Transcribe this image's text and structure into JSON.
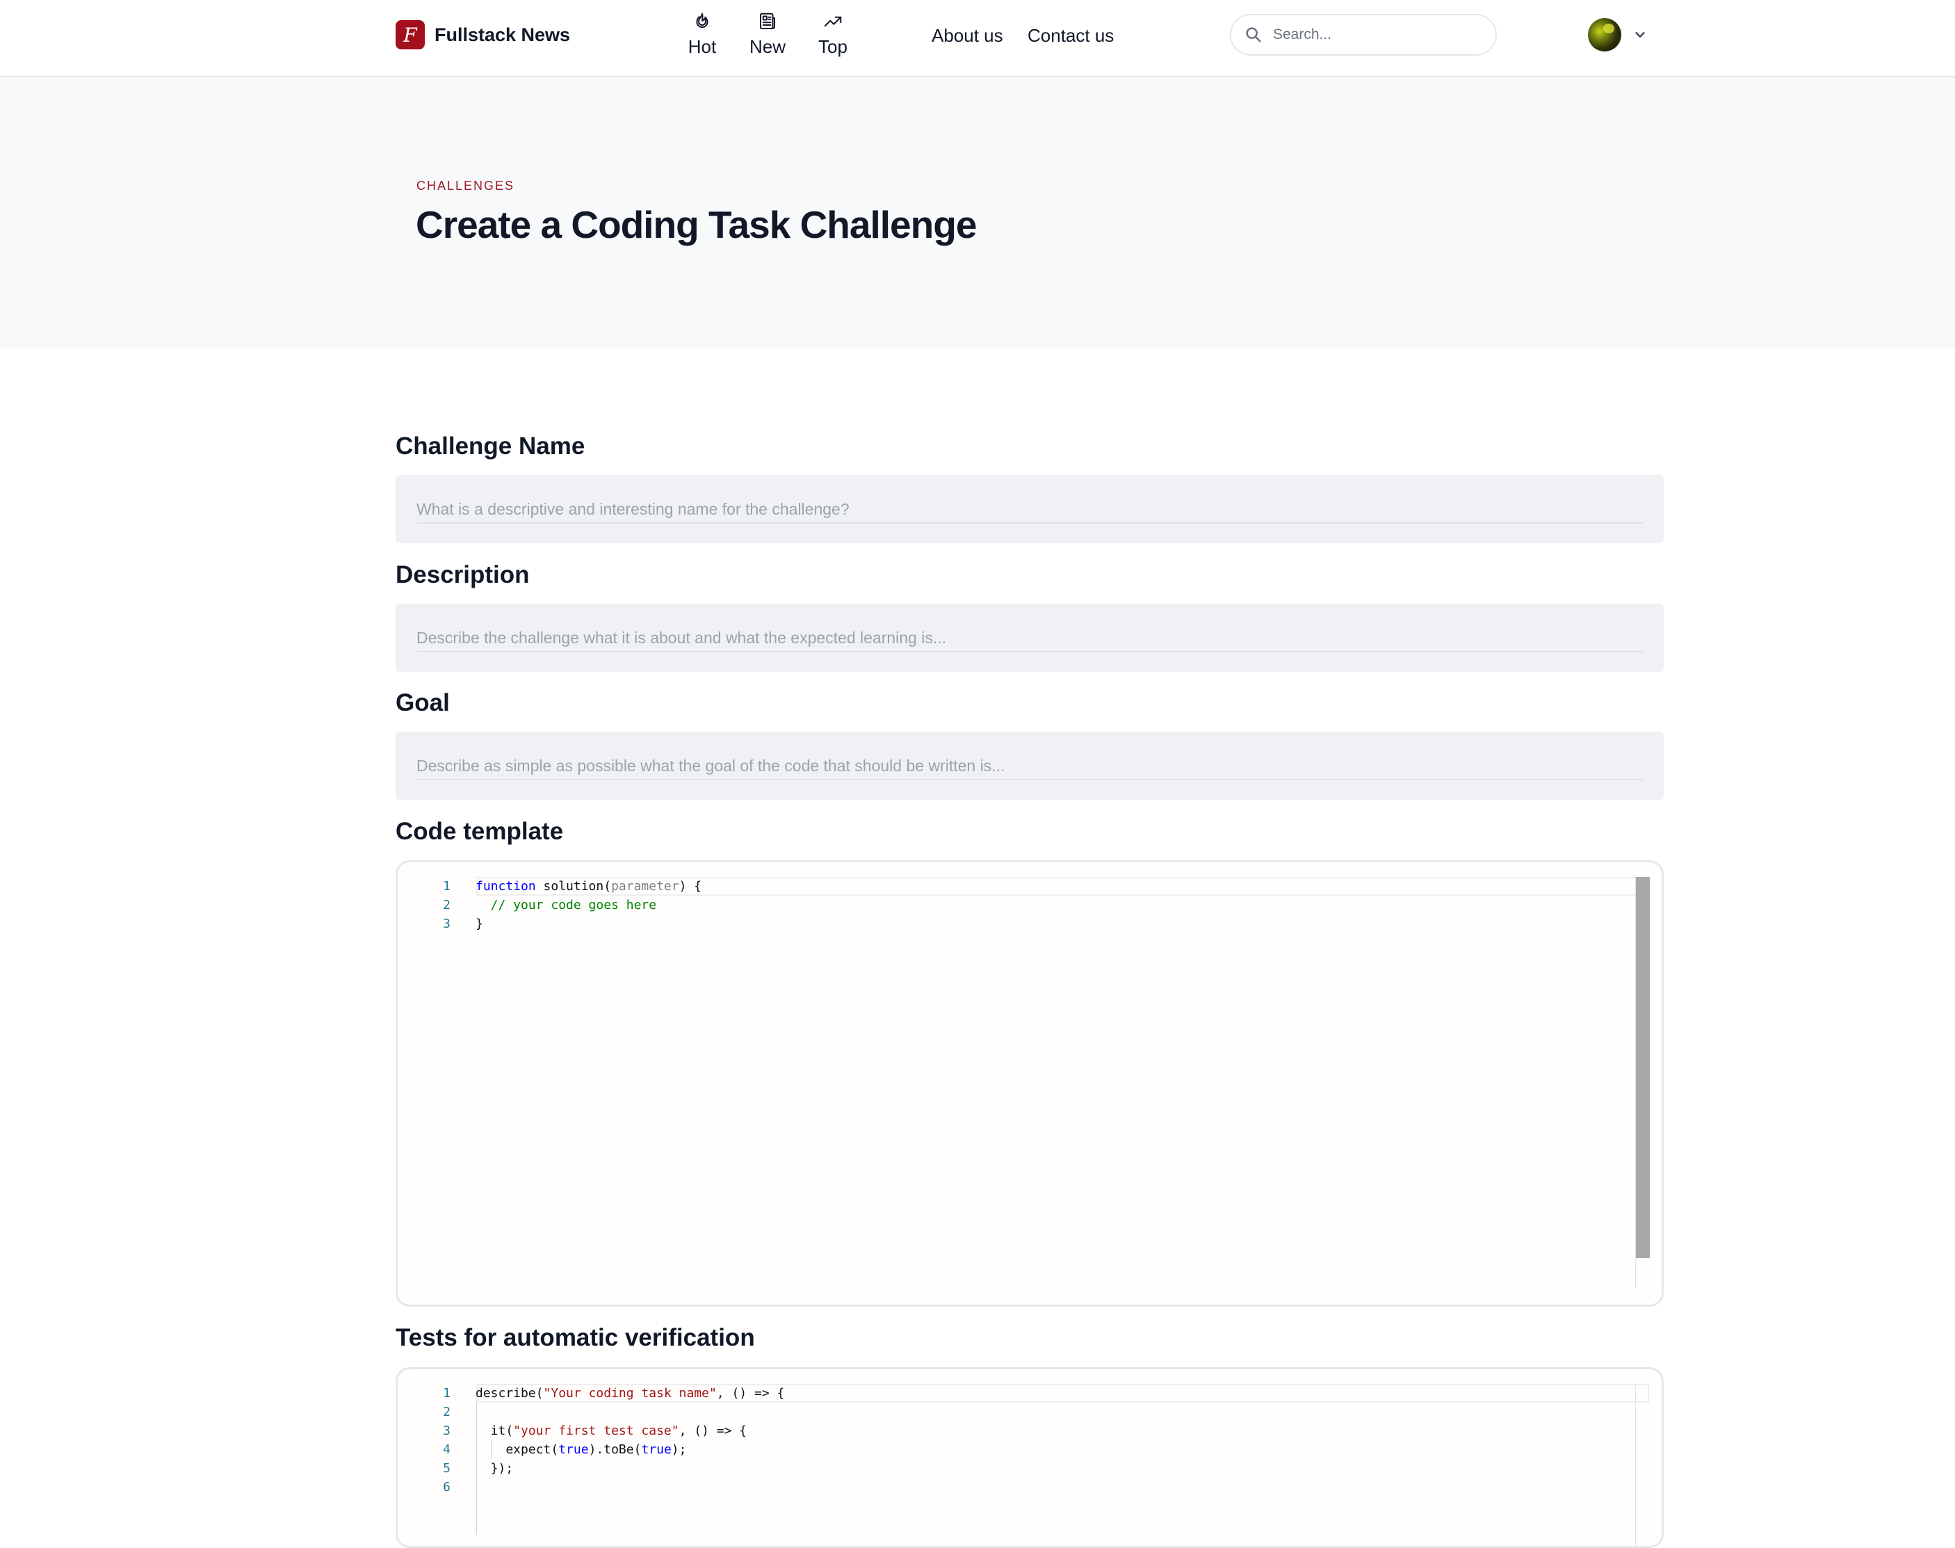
{
  "brand": {
    "name": "Fullstack News",
    "logo_letter": "F"
  },
  "nav": {
    "tabs": [
      {
        "label": "Hot",
        "icon": "flame-icon"
      },
      {
        "label": "New",
        "icon": "newspaper-icon"
      },
      {
        "label": "Top",
        "icon": "trending-up-icon"
      }
    ],
    "links": [
      "About us",
      "Contact us"
    ]
  },
  "search": {
    "placeholder": "Search...",
    "value": ""
  },
  "user": {
    "avatar": "avatar",
    "menu_icon": "chevron-down-icon"
  },
  "hero": {
    "eyebrow": "CHALLENGES",
    "title": "Create a Coding Task Challenge"
  },
  "form": {
    "name": {
      "label": "Challenge Name",
      "placeholder": "What is a descriptive and interesting name for the challenge?",
      "value": ""
    },
    "description": {
      "label": "Description",
      "placeholder": "Describe the challenge what it is about and what the expected learning is...",
      "value": ""
    },
    "goal": {
      "label": "Goal",
      "placeholder": "Describe as simple as possible what the goal of the code that should be written is...",
      "value": ""
    },
    "code_template": {
      "label": "Code template",
      "lines": [
        {
          "n": "1",
          "kw": "function",
          "name": " solution(",
          "param": "parameter",
          "rest": ") {"
        },
        {
          "n": "2",
          "comment": "  // your code goes here"
        },
        {
          "n": "3",
          "text": "}"
        }
      ]
    },
    "tests": {
      "label": "Tests for automatic verification",
      "lines": [
        {
          "n": "1",
          "pre": "describe(",
          "str": "\"Your coding task name\"",
          "post": ", () => {"
        },
        {
          "n": "2",
          "text": ""
        },
        {
          "n": "3",
          "pre": "  it(",
          "str": "\"your first test case\"",
          "post": ", () => {"
        },
        {
          "n": "4",
          "pre": "    expect(",
          "kw1": "true",
          "mid": ").toBe(",
          "kw2": "true",
          "post": ");"
        },
        {
          "n": "5",
          "text": "  });"
        },
        {
          "n": "6",
          "text": ""
        }
      ]
    }
  },
  "colors": {
    "brand": "#a30f1d",
    "eyebrow": "#9b1c26",
    "hero_bg": "#f8f9fb",
    "field_bg": "#f0f1f4"
  }
}
